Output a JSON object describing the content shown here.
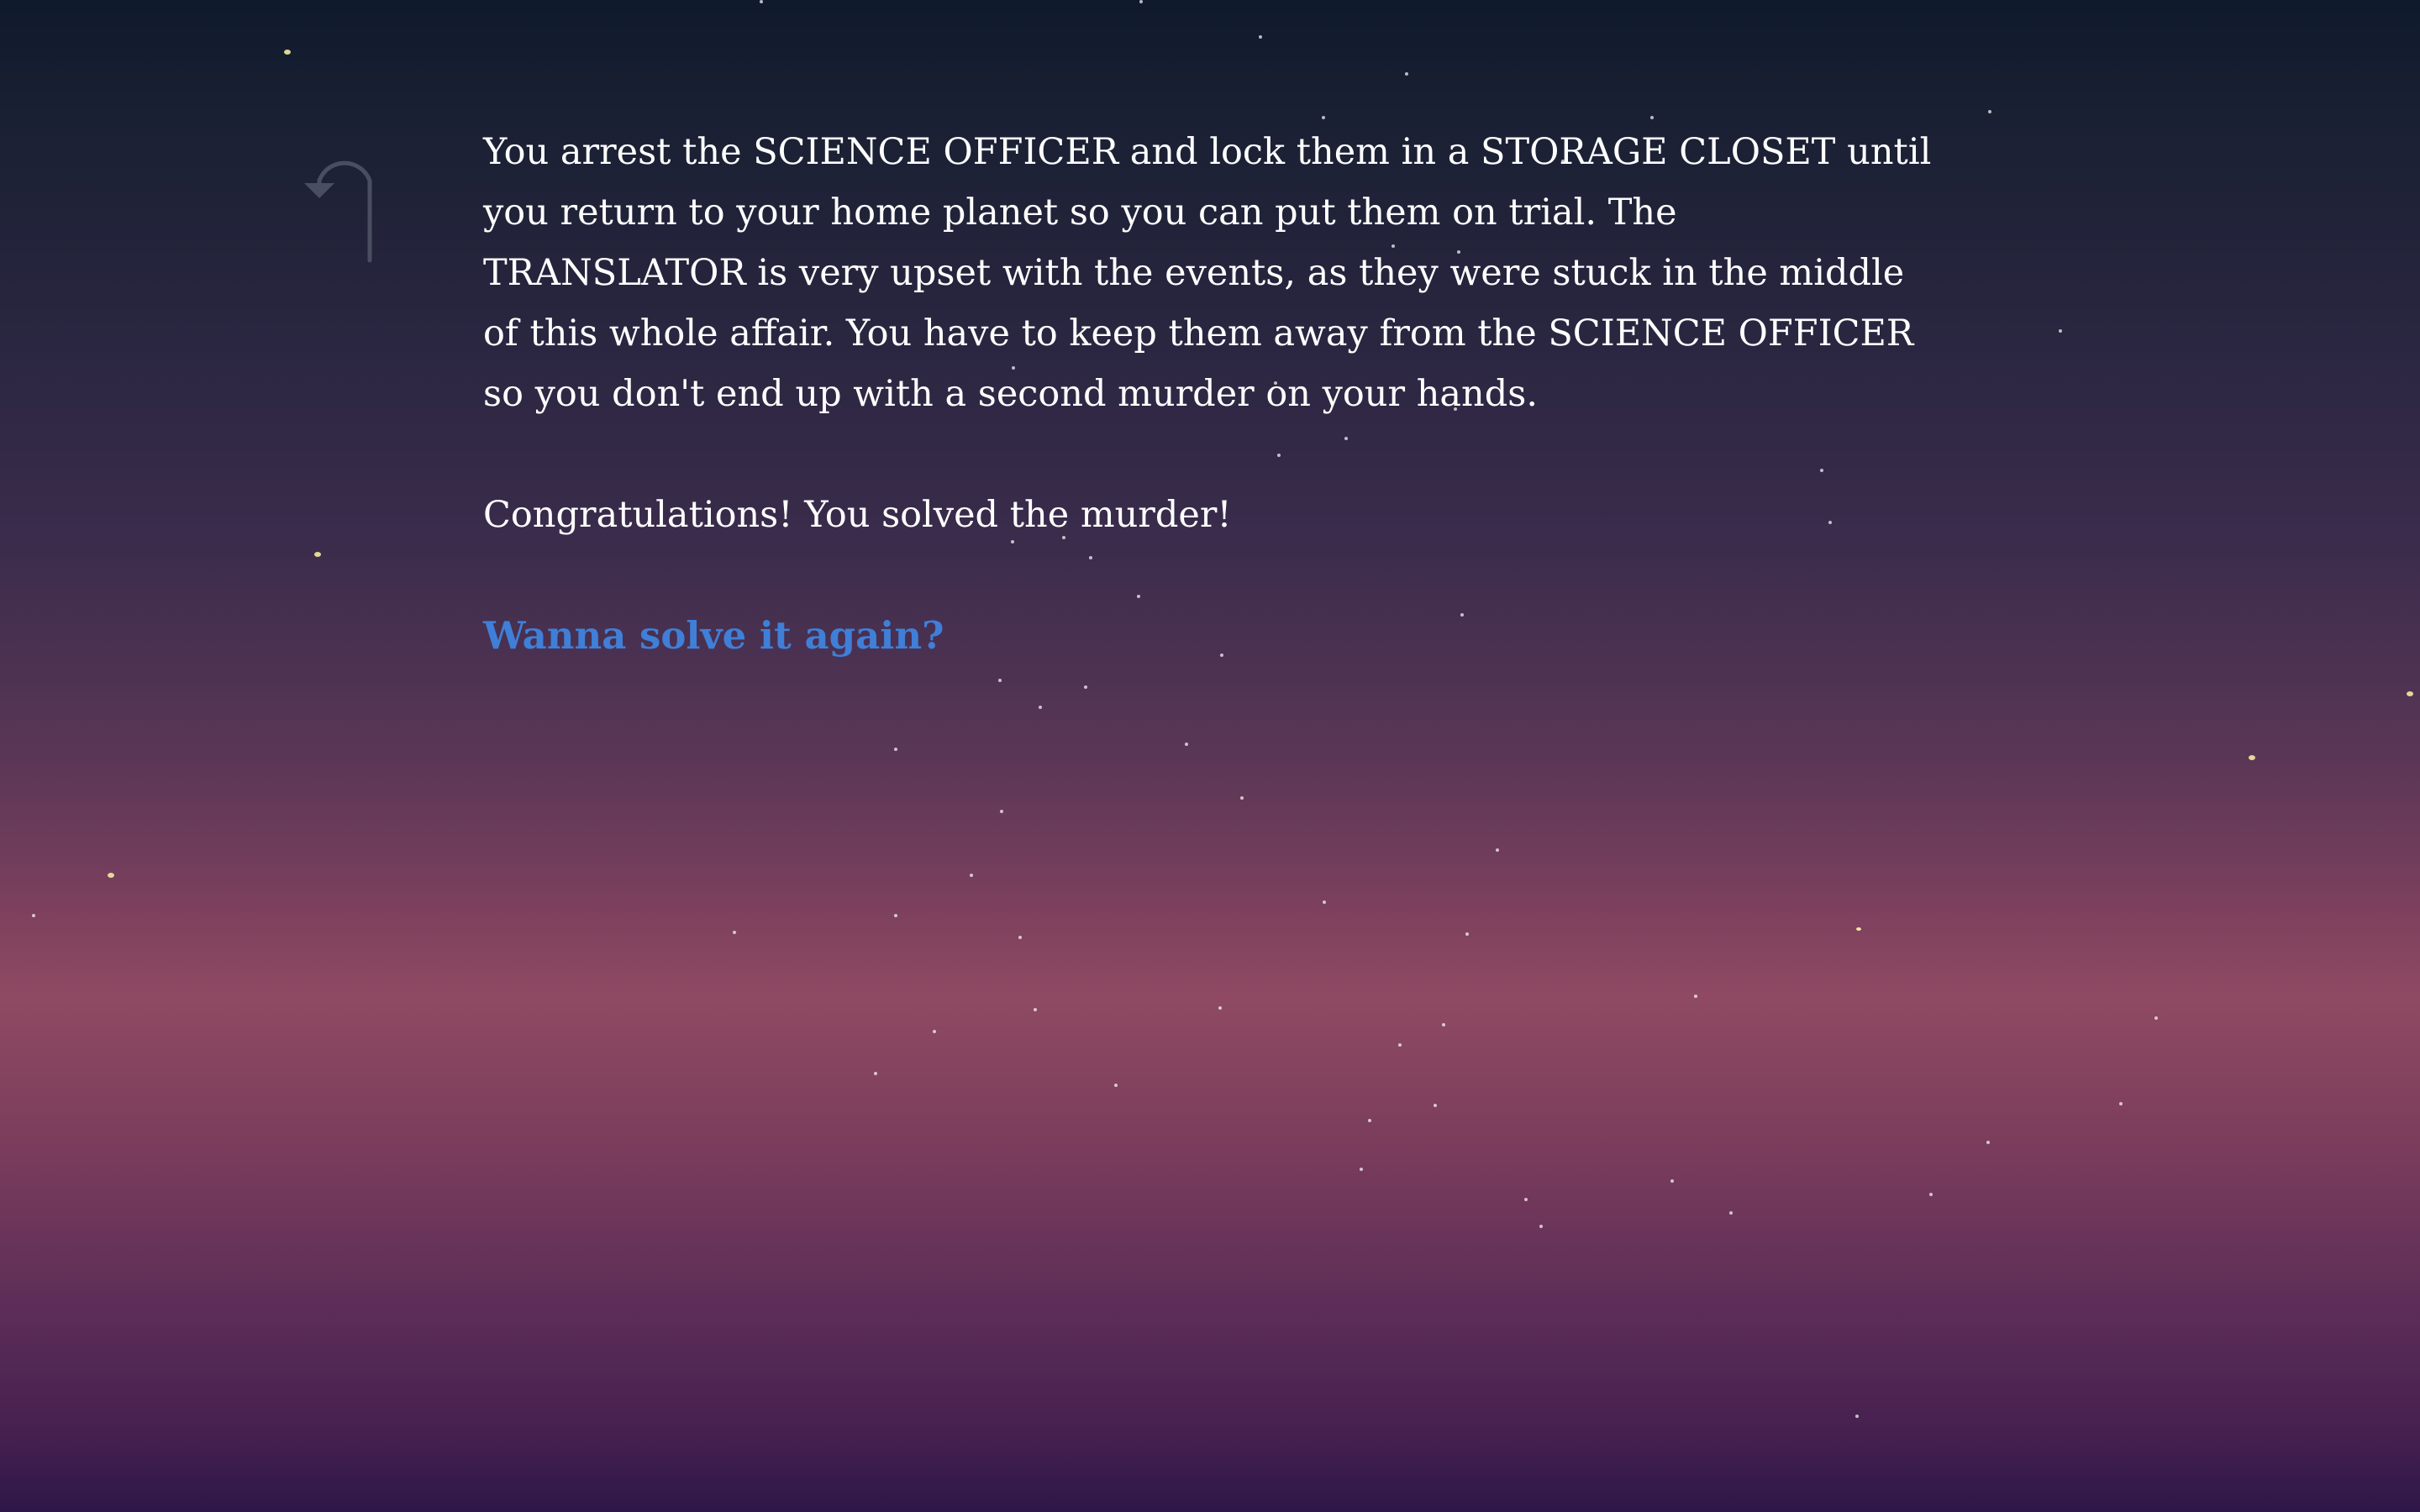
{
  "story": {
    "paragraph_1": "You arrest the SCIENCE OFFICER and lock them in a STORAGE CLOSET until you return to your home planet so you can put them on trial. The TRANSLATOR is very upset with the events, as they were stuck in the middle of this whole affair. You have to keep them away from the SCIENCE OFFICER so you don't end up with a second murder on your hands.",
    "paragraph_2": "Congratulations! You solved the murder!"
  },
  "choices": {
    "restart_label": "Wanna solve it again?"
  },
  "navigation": {
    "back_icon": "undo-arrow-icon"
  },
  "colors": {
    "text": "#ffffff",
    "link": "#3f7fd8",
    "back_icon": "#4a4e60",
    "star_white": "#ffffff",
    "star_yellow": "#f4eaa0"
  }
}
